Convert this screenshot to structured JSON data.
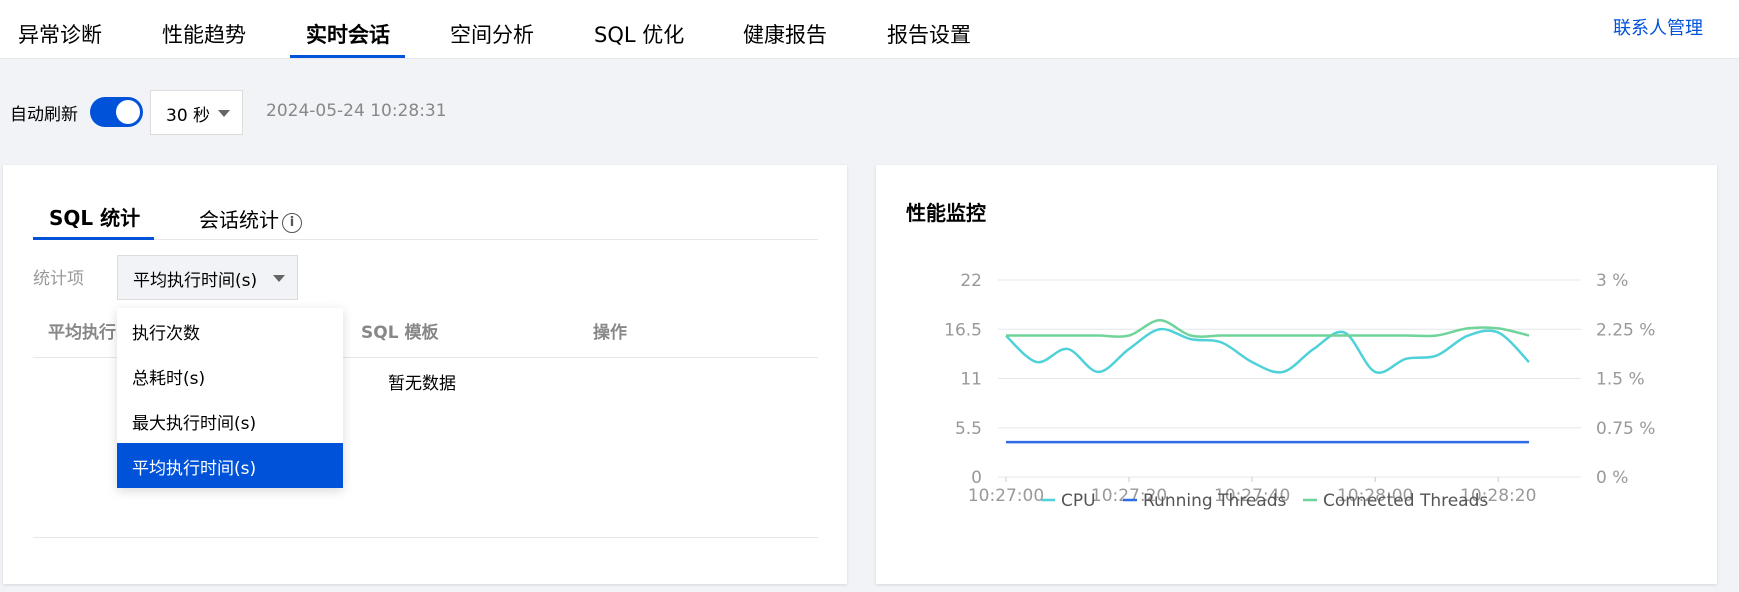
{
  "top_tabs": [
    "异常诊断",
    "性能趋势",
    "实时会话",
    "空间分析",
    "SQL 优化",
    "健康报告",
    "报告设置"
  ],
  "active_top_tab": "实时会话",
  "contact_link": "联系人管理",
  "refresh": {
    "label": "自动刷新",
    "enabled": true,
    "interval": "30 秒",
    "timestamp": "2024-05-24 10:28:31"
  },
  "left_card": {
    "tabs": [
      "SQL 统计",
      "会话统计"
    ],
    "active_tab": "SQL 统计",
    "stat_label": "统计项",
    "stat_selected": "平均执行时间(s)",
    "columns": [
      "平均执行",
      "SQL 模板",
      "操作"
    ],
    "empty_text": "暂无数据",
    "dropdown_options": [
      "执行次数",
      "总耗时(s)",
      "最大执行时间(s)",
      "平均执行时间(s)"
    ],
    "dropdown_selected_index": 3
  },
  "right_card": {
    "title": "性能监控"
  },
  "colors": {
    "accent": "#0052d9",
    "cpu": "#4fd1d9",
    "running_threads": "#2e6be6",
    "connected_threads": "#6fd39a"
  },
  "chart_data": {
    "type": "line",
    "x": [
      "10:27:00",
      "10:27:05",
      "10:27:10",
      "10:27:15",
      "10:27:20",
      "10:27:25",
      "10:27:30",
      "10:27:35",
      "10:27:40",
      "10:27:45",
      "10:27:50",
      "10:27:55",
      "10:28:00",
      "10:28:05",
      "10:28:10",
      "10:28:15",
      "10:28:20",
      "10:28:25"
    ],
    "x_ticks": [
      "10:27:00",
      "10:27:20",
      "10:27:40",
      "10:28:00",
      "10:28:20"
    ],
    "y_left_ticks": [
      "0",
      "5.5",
      "11",
      "16.5",
      "22"
    ],
    "y_left_range": [
      0,
      22
    ],
    "y_right_ticks": [
      "0 %",
      "0.75 %",
      "1.5 %",
      "2.25 %",
      "3 %"
    ],
    "y_right_range": [
      0,
      3
    ],
    "grid": true,
    "legend_position": "bottom",
    "series": [
      {
        "name": "CPU",
        "axis": "right",
        "color": "#4fd1d9",
        "values": [
          2.15,
          1.75,
          1.95,
          1.6,
          1.95,
          2.25,
          2.1,
          2.05,
          1.75,
          1.6,
          1.95,
          2.2,
          1.6,
          1.8,
          1.85,
          2.15,
          2.2,
          1.75
        ]
      },
      {
        "name": "Running Threads",
        "axis": "left",
        "values": [
          3.9,
          3.9,
          3.9,
          3.9,
          3.9,
          3.9,
          3.9,
          3.9,
          3.9,
          3.9,
          3.9,
          3.9,
          3.9,
          3.9,
          3.9,
          3.9,
          3.9,
          3.9
        ]
      },
      {
        "name": "Connected Threads",
        "axis": "left",
        "values": [
          15.8,
          15.8,
          15.8,
          15.8,
          15.8,
          17.5,
          15.8,
          15.8,
          15.8,
          15.8,
          15.8,
          15.8,
          15.8,
          15.8,
          15.8,
          16.6,
          16.6,
          15.8
        ]
      }
    ]
  }
}
